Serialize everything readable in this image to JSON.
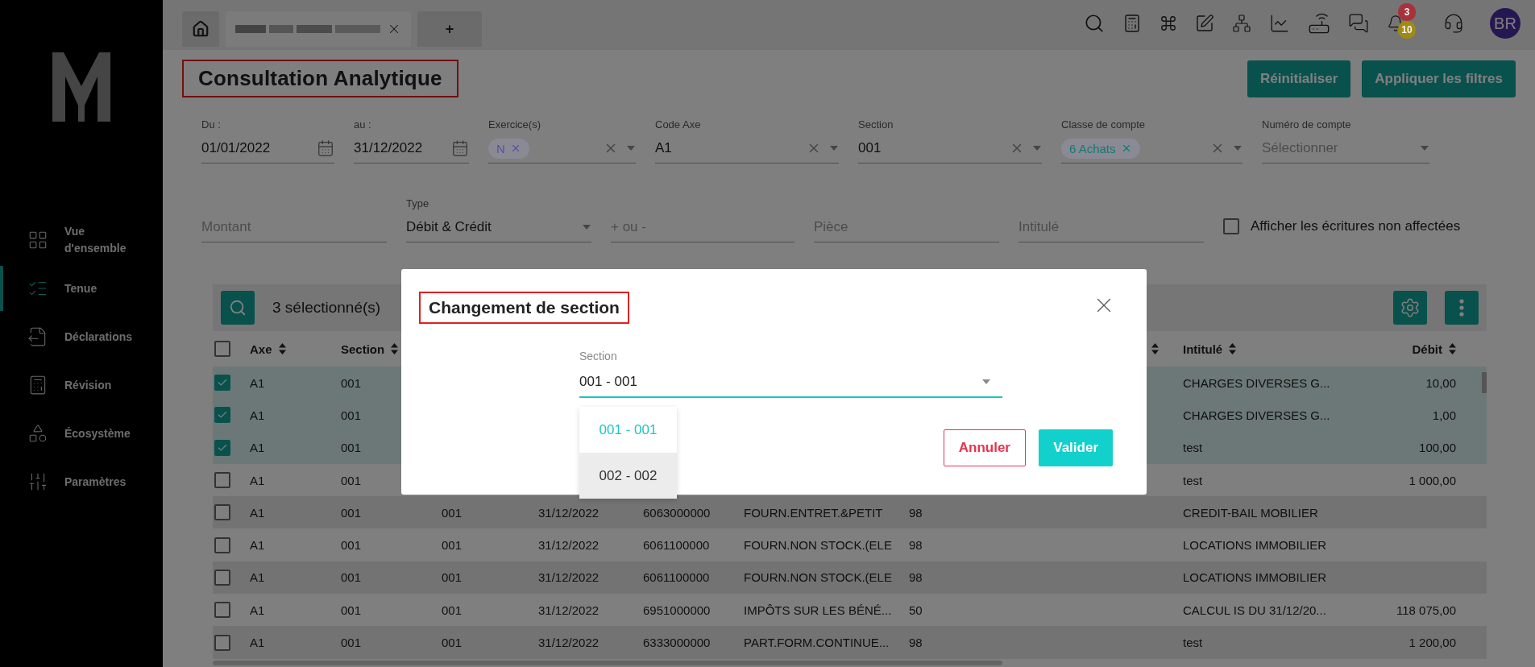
{
  "sidebar": {
    "items": [
      {
        "kind": "overview",
        "label": "Vue d'ensemble",
        "selected": false
      },
      {
        "kind": "ledger",
        "label": "Tenue",
        "selected": true
      },
      {
        "kind": "declarations",
        "label": "Déclarations",
        "selected": false
      },
      {
        "kind": "revision",
        "label": "Révision",
        "selected": false
      },
      {
        "kind": "ecosystem",
        "label": "Écosystème",
        "selected": false
      },
      {
        "kind": "settings",
        "label": "Paramètres",
        "selected": false
      }
    ]
  },
  "tabs": [
    {
      "kind": "home",
      "selected": false
    },
    {
      "kind": "document",
      "selected": true
    },
    {
      "kind": "new",
      "label": "+",
      "selected": false
    }
  ],
  "toolbar": {
    "notifications": [
      {
        "count": "3",
        "color": "#a8323c"
      },
      {
        "count": "10",
        "color": "#a08a12"
      }
    ],
    "avatar": "BR"
  },
  "page": {
    "title": "Consultation Analytique",
    "buttons": [
      "Réinitialiser",
      "Appliquer les filtres"
    ]
  },
  "filters": [
    {
      "kind": "date",
      "label": "Du :",
      "value": "01/01/2022"
    },
    {
      "kind": "date",
      "label": "au :",
      "value": "31/12/2022"
    },
    {
      "kind": "select",
      "label": "Exercice(s)",
      "chips": [
        {
          "label": "N",
          "color": "#5a4fa8"
        }
      ],
      "clearable": true
    },
    {
      "kind": "select",
      "label": "Code Axe",
      "value": "A1",
      "clearable": true
    },
    {
      "kind": "select",
      "label": "Section",
      "value": "001",
      "clearable": true
    },
    {
      "kind": "select",
      "label": "Classe de compte",
      "chips": [
        {
          "label": "6 Achats",
          "color": "#127a72"
        }
      ],
      "clearable": true
    },
    {
      "kind": "select",
      "label": "Numéro de compte",
      "placeholder": "Sélectionner",
      "clearable": false
    }
  ],
  "filters_row2": [
    {
      "kind": "text",
      "placeholder": "Montant"
    },
    {
      "kind": "select",
      "label": "Type",
      "value": "Débit & Crédit",
      "clearable": false
    },
    {
      "kind": "text",
      "placeholder": "+ ou -"
    },
    {
      "kind": "text",
      "placeholder": "Pièce"
    },
    {
      "kind": "text",
      "placeholder": "Intitulé"
    },
    {
      "kind": "checkbox",
      "label": "Afficher les écritures non affectées",
      "checked": false
    }
  ],
  "table": {
    "selection_count": "3 sélectionné(s)",
    "all_selected": false,
    "columns": [
      {
        "label": "Axe",
        "sortable": true
      },
      {
        "label": "Section",
        "sortable": true
      },
      {},
      {},
      {},
      {},
      {
        "sortable": true
      },
      {
        "label": "Intitulé",
        "sortable": true
      },
      {
        "label": "Débit",
        "sortable": true
      }
    ],
    "rows": [
      {
        "selected": true,
        "axe": "A1",
        "section": "001",
        "intitule": "CHARGES DIVERSES G...",
        "debit": "10,00"
      },
      {
        "selected": true,
        "axe": "A1",
        "section": "001",
        "intitule": "CHARGES DIVERSES G...",
        "debit": "1,00"
      },
      {
        "selected": true,
        "axe": "A1",
        "section": "001",
        "intitule": "test",
        "debit": "100,00"
      },
      {
        "selected": false,
        "axe": "A1",
        "section": "001",
        "intitule": "test",
        "debit": "1 000,00"
      },
      {
        "selected": false,
        "axe": "A1",
        "section": "001",
        "column_3": "001",
        "date": "31/12/2022",
        "compte": "6063000000",
        "libelle": "FOURN.ENTRET.&PETIT",
        "column_7": "98",
        "intitule": "CREDIT-BAIL MOBILIER"
      },
      {
        "selected": false,
        "axe": "A1",
        "section": "001",
        "column_3": "001",
        "date": "31/12/2022",
        "compte": "6061100000",
        "libelle": "FOURN.NON STOCK.(ELE",
        "column_7": "98",
        "intitule": "LOCATIONS IMMOBILIER"
      },
      {
        "selected": false,
        "axe": "A1",
        "section": "001",
        "column_3": "001",
        "date": "31/12/2022",
        "compte": "6061100000",
        "libelle": "FOURN.NON STOCK.(ELE",
        "column_7": "98",
        "intitule": "LOCATIONS IMMOBILIER"
      },
      {
        "selected": false,
        "axe": "A1",
        "section": "001",
        "column_3": "001",
        "date": "31/12/2022",
        "compte": "6951000000",
        "libelle": "IMPÔTS SUR LES BÉNÉ...",
        "column_7": "50",
        "intitule": "CALCUL IS DU 31/12/20...",
        "debit": "118 075,00"
      },
      {
        "selected": false,
        "axe": "A1",
        "section": "001",
        "column_3": "001",
        "date": "31/12/2022",
        "compte": "6333000000",
        "libelle": "PART.FORM.CONTINUE...",
        "column_7": "98",
        "intitule": "test",
        "debit": "1 200,00"
      }
    ]
  },
  "modal": {
    "title": "Changement de section",
    "field": {
      "label": "Section",
      "value": "001 - 001",
      "options": [
        {
          "label": "001 - 001",
          "selected": true,
          "hovered": false
        },
        {
          "label": "002 - 002",
          "selected": false,
          "hovered": true
        }
      ]
    },
    "buttons": [
      {
        "kind": "cancel",
        "label": "Annuler"
      },
      {
        "kind": "confirm",
        "label": "Valider"
      }
    ]
  }
}
